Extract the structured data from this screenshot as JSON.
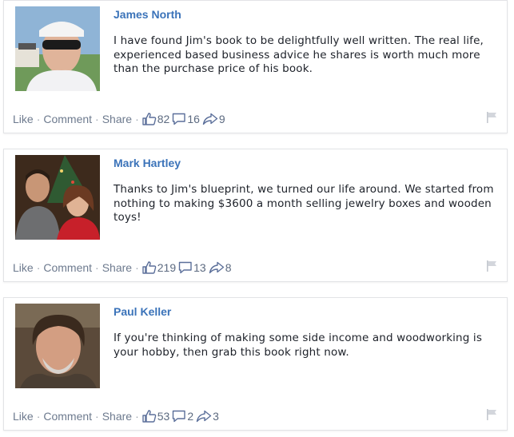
{
  "actions": {
    "like_label": "Like",
    "comment_label": "Comment",
    "share_label": "Share",
    "separator": "·"
  },
  "posts": [
    {
      "author": "James North",
      "text": "I have found Jim's book to be delightfully well written. The real life, experienced based business advice he shares is worth much more than the purchase price of his book.",
      "likes": "82",
      "comments": "16",
      "shares": "9"
    },
    {
      "author": "Mark Hartley",
      "text": "Thanks to Jim's blueprint, we turned our life around. We started from nothing to making $3600 a month selling jewelry boxes and wooden toys!",
      "likes": "219",
      "comments": "13",
      "shares": "8"
    },
    {
      "author": "Paul Keller",
      "text": "If you're thinking of making some side income and woodworking is your hobby, then grab this book right now.",
      "likes": "53",
      "comments": "2",
      "shares": "3"
    }
  ],
  "icons": {
    "like": "thumbs-up-icon",
    "comment": "speech-bubble-icon",
    "share": "share-arrow-icon",
    "flag": "flag-icon"
  },
  "colors": {
    "author_name": "#3b73b9",
    "text": "#1d2129",
    "action_text": "#6d7a8e",
    "counts": "#5c6a80"
  }
}
